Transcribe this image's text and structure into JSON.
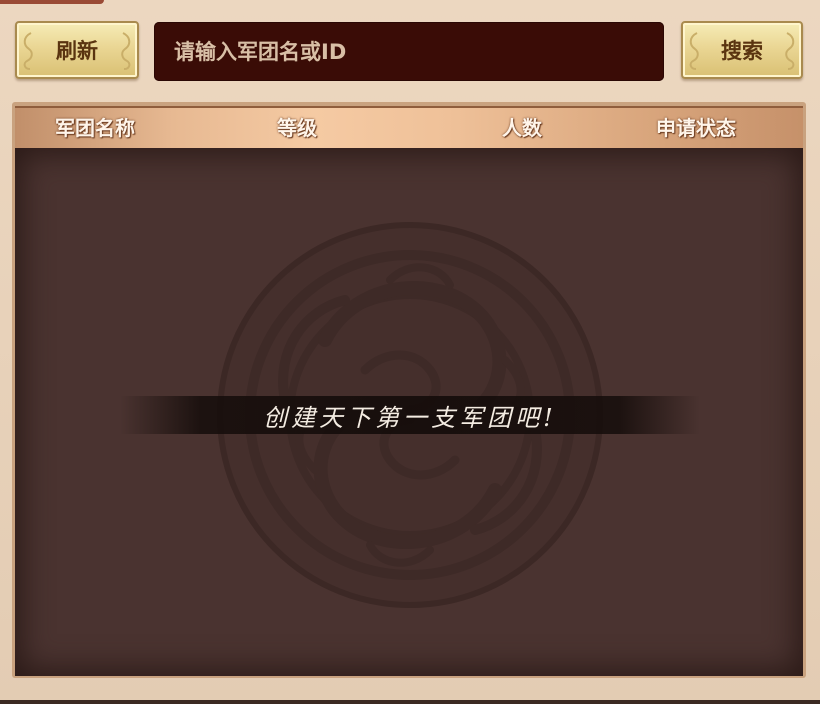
{
  "toolbar": {
    "refresh_label": "刷新",
    "search_label": "搜索",
    "search_placeholder": "请输入军团名或ID"
  },
  "table": {
    "columns": [
      "军团名称",
      "等级",
      "人数",
      "申请状态"
    ],
    "rows": []
  },
  "empty_state": {
    "message": "创建天下第一支军团吧!"
  },
  "icons": {
    "emblem": "dragon-emblem-icon",
    "button_curl": "scroll-curl-icon"
  },
  "colors": {
    "button_gold": "#ead694",
    "search_bg": "#3a0c06",
    "list_bg": "#4a3330",
    "header_tan": "#e7b992"
  }
}
